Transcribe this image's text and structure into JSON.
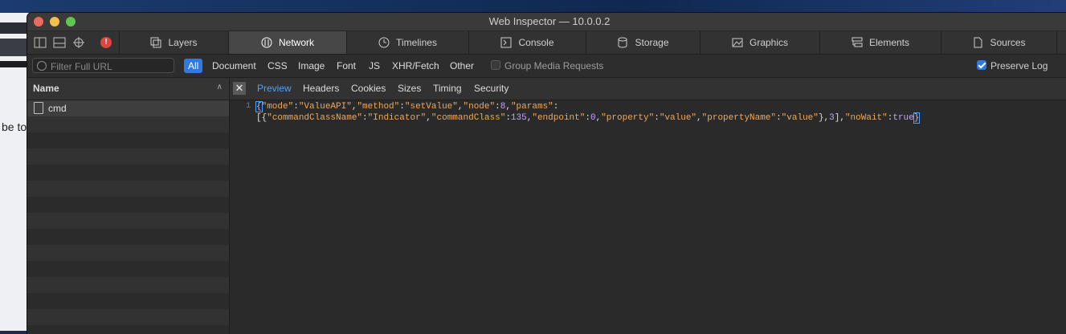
{
  "background": {
    "partial_text": "be to"
  },
  "window": {
    "title": "Web Inspector — 10.0.0.2"
  },
  "tabs": [
    {
      "label": "Layers",
      "icon": "layers-icon"
    },
    {
      "label": "Network",
      "icon": "network-icon"
    },
    {
      "label": "Timelines",
      "icon": "timelines-icon"
    },
    {
      "label": "Console",
      "icon": "console-icon"
    },
    {
      "label": "Storage",
      "icon": "storage-icon"
    },
    {
      "label": "Graphics",
      "icon": "graphics-icon"
    },
    {
      "label": "Elements",
      "icon": "elements-icon"
    },
    {
      "label": "Sources",
      "icon": "sources-icon"
    }
  ],
  "filter": {
    "placeholder": "Filter Full URL",
    "types": [
      "All",
      "Document",
      "CSS",
      "Image",
      "Font",
      "JS",
      "XHR/Fetch",
      "Other"
    ],
    "group_media_label": "Group Media Requests",
    "preserve_log_label": "Preserve Log"
  },
  "left_panel": {
    "header": "Name",
    "requests": [
      {
        "name": "cmd"
      }
    ]
  },
  "detail": {
    "tabs": [
      "Preview",
      "Headers",
      "Cookies",
      "Sizes",
      "Timing",
      "Security"
    ],
    "line_number": "1",
    "json_line1": "{\"mode\":\"ValueAPI\",\"method\":\"setValue\",\"node\":8,\"params\":",
    "json_line2": "[{\"commandClassName\":\"Indicator\",\"commandClass\":135,\"endpoint\":0,\"property\":\"value\",\"propertyName\":\"value\"},3],\"noWait\":true}"
  },
  "colors": {
    "accent": "#2f7ae0",
    "active_tab_text": "#4aa3ff",
    "json_key": "#f0a85a"
  }
}
